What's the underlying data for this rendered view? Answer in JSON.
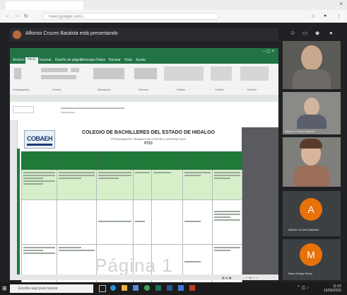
{
  "browser": {
    "url": "meet.google.com/..."
  },
  "meet": {
    "presenting_text": "Alfonso Cruces Bautista está presentando"
  },
  "excel": {
    "menu_tabs": [
      "Archivo",
      "Inicio",
      "Insertar",
      "Diseño de página",
      "Fórmulas",
      "Datos",
      "Revisar",
      "Vista",
      "Ayuda"
    ],
    "ribbon_labels": [
      "Portapapeles",
      "Fuente",
      "Alineación",
      "Número",
      "Estilos",
      "Celdas",
      "Edición"
    ],
    "logo_text": "COBAEH",
    "title": "COLEGIO DE BACHILLERES DEL ESTADO DE HIDALGO",
    "subtitle": "PROGRAMA DE TRABAJO DE CONTROL INTERNO 2020",
    "subtitle2": "PTCI",
    "watermark": "Página 1"
  },
  "participants": [
    {
      "name": ""
    },
    {
      "name": "Alfonso Cruces Bautista"
    },
    {
      "name": ""
    },
    {
      "initial": "A",
      "name": "Alfonso Cruces Bautista",
      "color": "#e8710a"
    },
    {
      "initial": "M",
      "name": "Mara Ortega Pérez",
      "color": "#e8710a"
    }
  ],
  "taskbar": {
    "search_placeholder": "Escribe aquí para buscar",
    "time": "11:02",
    "date": "15/06/2020"
  },
  "colors": {
    "excel_green": "#217346",
    "meet_bg": "#202124",
    "avatar_orange": "#e8710a"
  }
}
